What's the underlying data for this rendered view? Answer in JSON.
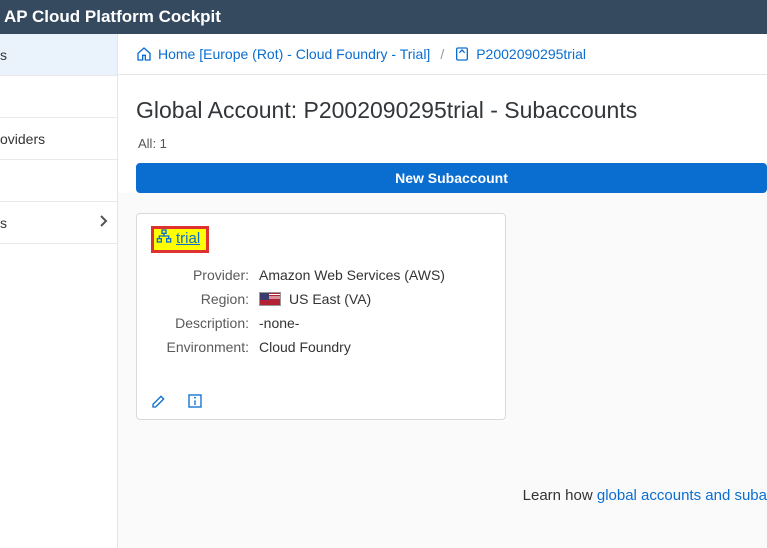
{
  "topbar": {
    "title": "AP Cloud Platform Cockpit"
  },
  "sidebar": {
    "items": [
      {
        "label": "s"
      },
      {
        "label": ""
      },
      {
        "label": "oviders"
      },
      {
        "label": ""
      },
      {
        "label": "s",
        "chevron": true
      }
    ]
  },
  "breadcrumb": {
    "home": "Home [Europe (Rot) - Cloud Foundry - Trial]",
    "account": "P2002090295trial"
  },
  "page": {
    "title": "Global Account: P2002090295trial - Subaccounts",
    "all_label": "All: 1",
    "new_btn": "New Subaccount"
  },
  "card": {
    "title": "trial",
    "fields": {
      "provider_label": "Provider:",
      "provider_value": "Amazon Web Services (AWS)",
      "region_label": "Region:",
      "region_value": "US East (VA)",
      "description_label": "Description:",
      "description_value": "-none-",
      "environment_label": "Environment:",
      "environment_value": "Cloud Foundry"
    }
  },
  "footer": {
    "learn_prefix": "Learn how ",
    "learn_link": "global accounts and suba"
  }
}
